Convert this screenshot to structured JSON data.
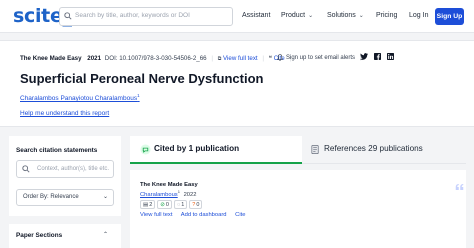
{
  "nav": {
    "logo": "scite_",
    "search_placeholder": "Search by title, author, keywords or DOI",
    "links": [
      "Assistant",
      "Product",
      "Solutions",
      "Pricing",
      "Log In"
    ],
    "signup": "Sign Up"
  },
  "paper": {
    "source": "The Knee Made Easy",
    "year": "2021",
    "doi": "DOI: 10.1007/978-3-030-54506-2_66",
    "view_full_text": "View full text",
    "cite": "Cite",
    "alerts": "Sign up to set email alerts",
    "title": "Superficial Peroneal Nerve Dysfunction",
    "authors": "Charalambos Panayiotou Charalambous",
    "author_sup": "1",
    "help": "Help me understand this report"
  },
  "sidebar": {
    "search_heading": "Search citation statements",
    "context_placeholder": "Context, author(s), title etc.",
    "order_label": "Order By: Relevance",
    "sections_heading": "Paper Sections"
  },
  "tabs": {
    "cited_by": "Cited by 1 publication",
    "references": "References 29 publications"
  },
  "citation": {
    "source": "The Knee Made Easy",
    "author": "Charalambous",
    "author_sup": "1",
    "year": "2022",
    "badges": [
      "2",
      "0",
      "1",
      "0"
    ],
    "actions": [
      "View full text",
      "Add to dashboard",
      "Cite"
    ]
  },
  "colors": {
    "brand": "#1e63c8",
    "button": "#1d4ed8",
    "accent_green": "#16a34a"
  }
}
